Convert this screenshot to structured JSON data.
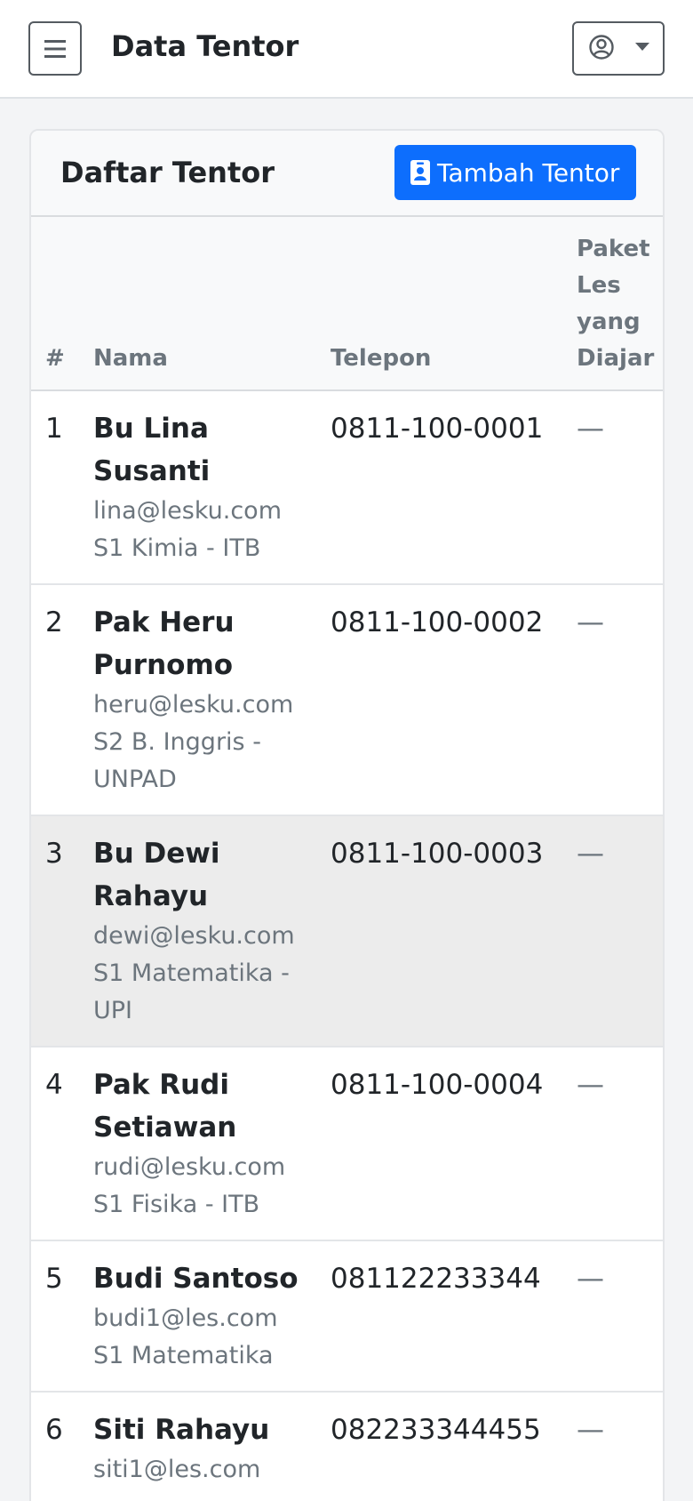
{
  "header": {
    "title": "Data Tentor"
  },
  "card": {
    "title": "Daftar Tentor",
    "add_button_label": "Tambah Tentor"
  },
  "table": {
    "columns": [
      "#",
      "Nama",
      "Telepon",
      "Paket Les yang Diajar"
    ],
    "rows": [
      {
        "num": "1",
        "name": "Bu Lina Susanti",
        "email": "lina@lesku.com",
        "edu": "S1 Kimia - ITB",
        "phone": "0811-100-0001",
        "paket": "—"
      },
      {
        "num": "2",
        "name": "Pak Heru Purnomo",
        "email": "heru@lesku.com",
        "edu": "S2 B. Inggris - UNPAD",
        "phone": "0811-100-0002",
        "paket": "—"
      },
      {
        "num": "3",
        "name": "Bu Dewi Rahayu",
        "email": "dewi@lesku.com",
        "edu": "S1 Matematika - UPI",
        "phone": "0811-100-0003",
        "paket": "—"
      },
      {
        "num": "4",
        "name": "Pak Rudi Setiawan",
        "email": "rudi@lesku.com",
        "edu": "S1 Fisika - ITB",
        "phone": "0811-100-0004",
        "paket": "—"
      },
      {
        "num": "5",
        "name": "Budi Santoso",
        "email": "budi1@les.com",
        "edu": "S1 Matematika",
        "phone": "081122233344",
        "paket": "—"
      },
      {
        "num": "6",
        "name": "Siti Rahayu",
        "email": "siti1@les.com",
        "edu": "",
        "phone": "082233344455",
        "paket": "—"
      }
    ]
  },
  "icons": {
    "menu": "menu-icon",
    "user": "user-circle-icon",
    "caret": "caret-down-icon",
    "add": "contact-badge-icon"
  },
  "colors": {
    "primary": "#0d6efd",
    "muted": "#6c757d",
    "highlight_row": "#ececec"
  }
}
